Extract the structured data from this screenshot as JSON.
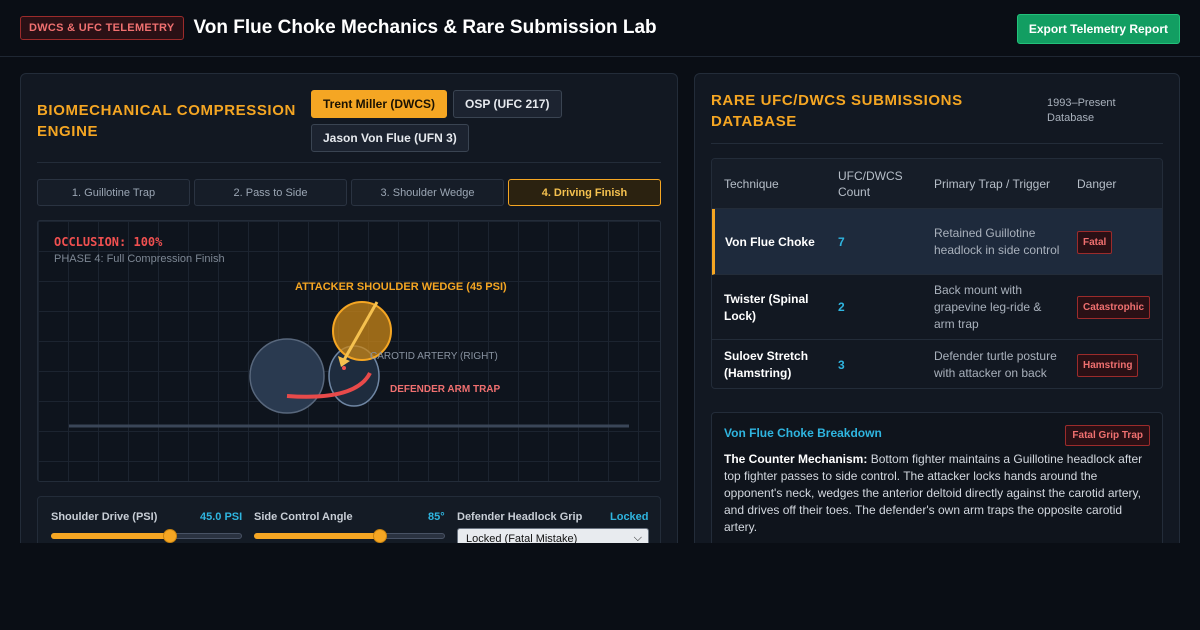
{
  "header": {
    "badge": "DWCS & UFC TELEMETRY",
    "title": "Von Flue Choke Mechanics & Rare Submission Lab",
    "export_label": "Export Telemetry Report"
  },
  "engine": {
    "title_line1": "BIOMECHANICAL COMPRESSION",
    "title_line2": "ENGINE",
    "fighters": [
      "Trent Miller (DWCS)",
      "OSP (UFC 217)",
      "Jason Von Flue (UFN 3)"
    ],
    "phases": [
      "1. Guillotine Trap",
      "2. Pass to Side",
      "3. Shoulder Wedge",
      "4. Driving Finish"
    ],
    "occlusion": "OCCLUSION: 100%",
    "phase_caption": "PHASE 4: Full Compression Finish",
    "labels": {
      "shoulder": "ATTACKER SHOULDER WEDGE (45 PSI)",
      "artery": "CAROTID ARTERY (RIGHT)",
      "arm": "DEFENDER ARM TRAP"
    },
    "controls": {
      "shoulder_label": "Shoulder Drive (PSI)",
      "shoulder_value": "45.0 PSI",
      "shoulder_fraction": 0.63,
      "angle_label": "Side Control Angle",
      "angle_value": "85°",
      "angle_fraction": 0.67,
      "grip_label": "Defender Headlock Grip",
      "grip_value": "Locked",
      "grip_select": "Locked (Fatal Mistake)"
    }
  },
  "database": {
    "title_line1": "RARE UFC/DWCS SUBMISSIONS",
    "title_line2": "DATABASE",
    "sub_line1": "1993–Present",
    "sub_line2": "Database",
    "columns": [
      "Technique",
      "UFC/DWCS Count",
      "Primary Trap / Trigger",
      "Danger"
    ],
    "rows": [
      {
        "technique": "Von Flue Choke",
        "count": "7",
        "trap": "Retained Guillotine headlock in side control",
        "danger": "Fatal"
      },
      {
        "technique": "Twister (Spinal Lock)",
        "count": "2",
        "trap": "Back mount with grapevine leg-ride & arm trap",
        "danger": "Catastrophic"
      },
      {
        "technique": "Suloev Stretch (Hamstring)",
        "count": "3",
        "trap": "Defender turtle posture with attacker on back",
        "danger": "Hamstring"
      }
    ],
    "breakdown": {
      "title": "Von Flue Choke Breakdown",
      "badge": "Fatal Grip Trap",
      "lead": "The Counter Mechanism:",
      "text": " Bottom fighter maintains a Guillotine headlock after top fighter passes to side control. The attacker locks hands around the opponent's neck, wedges the anterior deltoid directly against the carotid artery, and drives off their toes. The defender's own arm traps the opposite carotid artery."
    }
  },
  "colors": {
    "accent": "#f5a623",
    "cyan": "#2fb5e0",
    "danger": "#f05050",
    "export": "#129e62"
  }
}
